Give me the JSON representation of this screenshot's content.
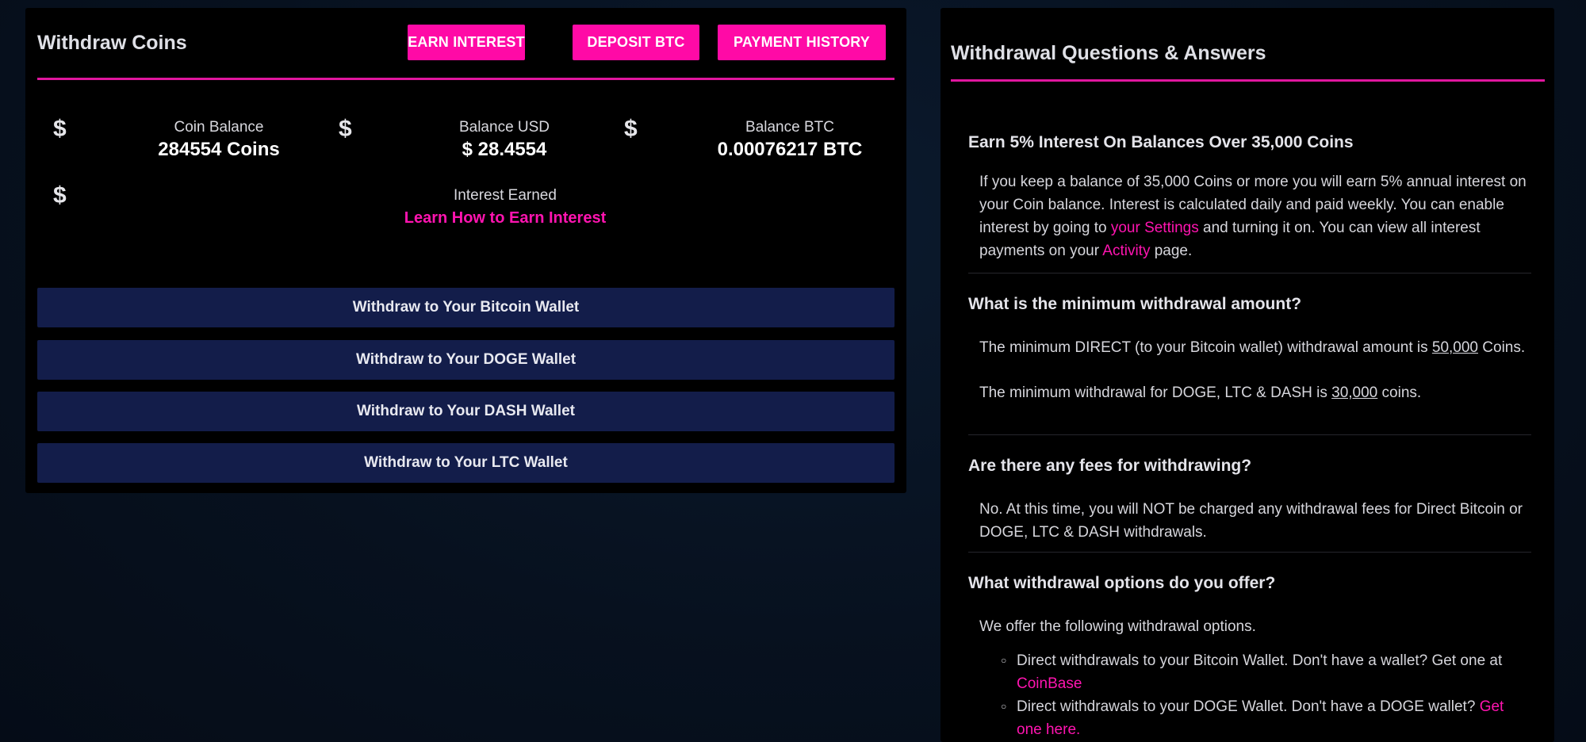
{
  "left": {
    "title": "Withdraw Coins",
    "buttons": {
      "earn_interest": "EARN INTEREST",
      "deposit_btc": "DEPOSIT BTC",
      "payment_history": "PAYMENT HISTORY"
    },
    "stats": {
      "currency_symbol": "$",
      "coin_balance_label": "Coin Balance",
      "coin_balance_value": "284554 Coins",
      "balance_usd_label": "Balance USD",
      "balance_usd_value": "$ 28.4554",
      "balance_btc_label": "Balance BTC",
      "balance_btc_value": "0.00076217 BTC",
      "interest_label": "Interest Earned",
      "interest_link": "Learn How to Earn Interest"
    },
    "withdraw_buttons": [
      "Withdraw to Your Bitcoin Wallet",
      "Withdraw to Your DOGE Wallet",
      "Withdraw to Your DASH Wallet",
      "Withdraw to Your LTC Wallet"
    ]
  },
  "right": {
    "title": "Withdrawal Questions & Answers",
    "q1": {
      "question": "Earn 5% Interest On Balances Over 35,000 Coins",
      "a_part1": "If you keep a balance of 35,000 Coins or more you will earn 5% annual interest on your Coin balance. Interest is calculated daily and paid weekly. You can enable interest by going to ",
      "a_link1": "your Settings",
      "a_part2": " and turning it on. You can view all interest payments on your ",
      "a_link2": "Activity",
      "a_part3": " page."
    },
    "q2": {
      "question": "What is the minimum withdrawal amount?",
      "a1_part1": "The minimum DIRECT (to your Bitcoin wallet) withdrawal amount is ",
      "a1_amount": "50,000",
      "a1_part2": " Coins.",
      "a2_part1": "The minimum withdrawal for DOGE, LTC & DASH is ",
      "a2_amount": "30,000",
      "a2_part2": " coins."
    },
    "q3": {
      "question": "Are there any fees for withdrawing?",
      "answer": "No. At this time, you will NOT be charged any withdrawal fees for Direct Bitcoin or DOGE, LTC & DASH withdrawals."
    },
    "q4": {
      "question": "What withdrawal options do you offer?",
      "intro": "We offer the following withdrawal options.",
      "opt1_text": "Direct withdrawals to your Bitcoin Wallet. Don't have a wallet? Get one at ",
      "opt1_link": "CoinBase",
      "opt2_text": "Direct withdrawals to your DOGE Wallet. Don't have a DOGE wallet? ",
      "opt2_link": "Get one here."
    }
  },
  "colors": {
    "accent_pink": "#ff0aa6",
    "withdraw_button_bg": "#131d4a",
    "panel_bg": "#000000"
  }
}
